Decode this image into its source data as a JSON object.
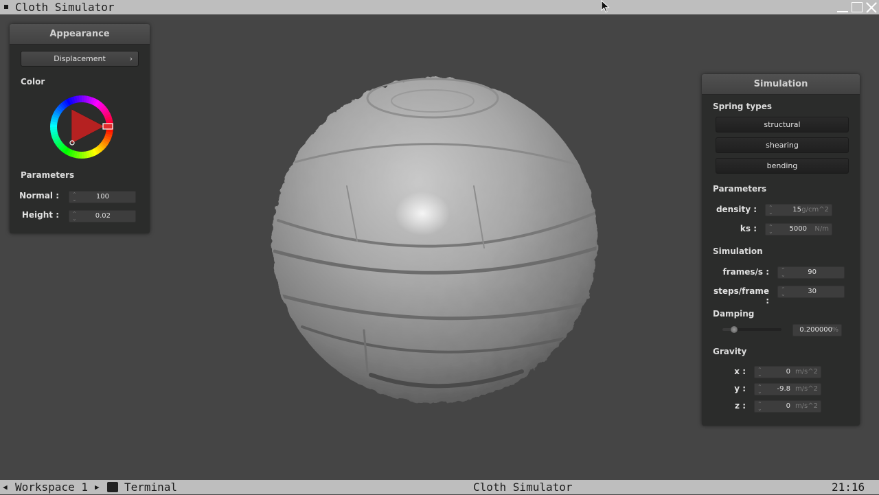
{
  "window": {
    "title": "Cloth Simulator",
    "controls": [
      "minimize-icon",
      "maximize-icon",
      "close-icon"
    ]
  },
  "appearance": {
    "title": "Appearance",
    "shader_dropdown": "Displacement",
    "color_label": "Color",
    "color_value": "#e02b2b",
    "params_label": "Parameters",
    "normal": {
      "label": "Normal :",
      "value": "100"
    },
    "height": {
      "label": "Height :",
      "value": "0.02"
    }
  },
  "simulation": {
    "title": "Simulation",
    "spring_types_label": "Spring types",
    "spring_buttons": [
      "structural",
      "shearing",
      "bending"
    ],
    "params_label": "Parameters",
    "density": {
      "label": "density :",
      "value": "15",
      "unit": "g/cm^2"
    },
    "ks": {
      "label": "ks :",
      "value": "5000",
      "unit": "N/m"
    },
    "sim_label": "Simulation",
    "fps": {
      "label": "frames/s :",
      "value": "90"
    },
    "steps": {
      "label": "steps/frame :",
      "value": "30"
    },
    "damping_label": "Damping",
    "damping": {
      "value": "0.200000",
      "unit": "%",
      "slider_level": 0.2
    },
    "gravity_label": "Gravity",
    "gx": {
      "label": "x :",
      "value": "0",
      "unit": "m/s^2"
    },
    "gy": {
      "label": "y :",
      "value": "-9.8",
      "unit": "m/s^2"
    },
    "gz": {
      "label": "z :",
      "value": "0",
      "unit": "m/s^2"
    }
  },
  "taskbar": {
    "workspace": "Workspace 1",
    "terminal": "Terminal",
    "app": "Cloth Simulator",
    "clock": "21:16"
  },
  "colors": {
    "background": "#454545",
    "panel": "#2b2c2b",
    "bars": "#bebebe",
    "accent_red": "#e02b2b"
  }
}
